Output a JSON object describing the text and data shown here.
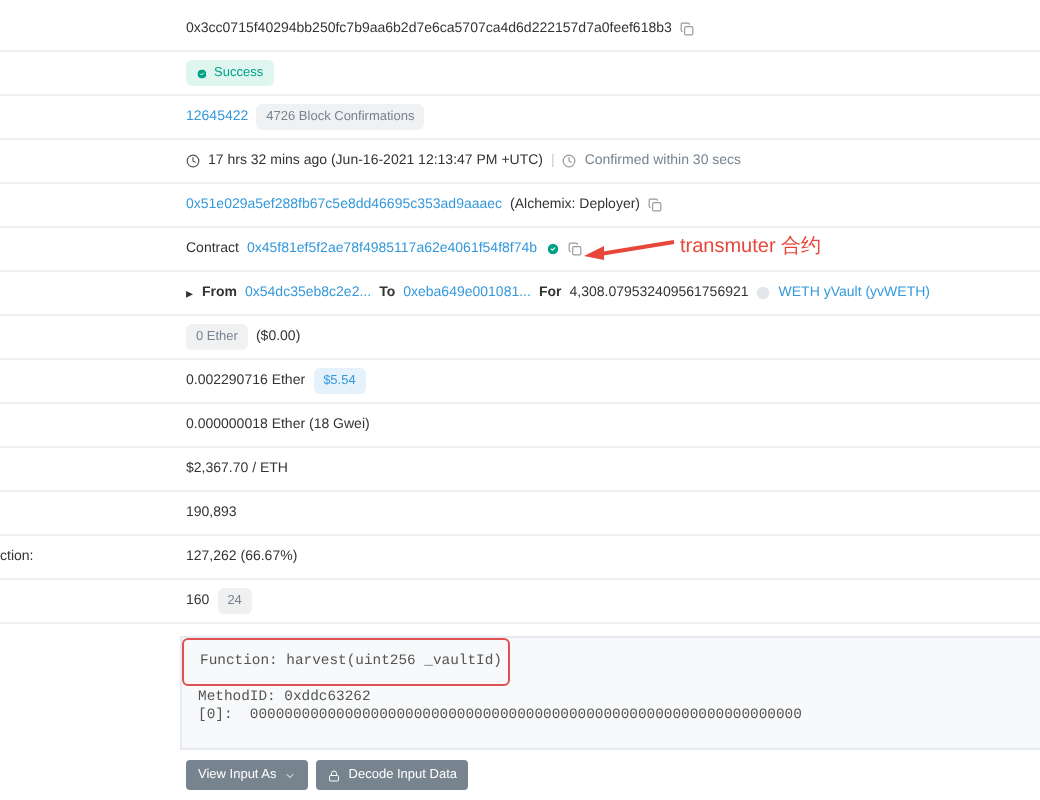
{
  "rows": [
    {
      "kind": "copytext",
      "label": "",
      "text": "0x3cc0715f40294bb250fc7b9aa6b2d7e6ca5707ca4d6d222157d7a0feef618b3"
    },
    {
      "kind": "status",
      "label": "",
      "text": "Success"
    },
    {
      "kind": "block",
      "label": "",
      "link": "12645422",
      "badge": "4726 Block Confirmations"
    },
    {
      "kind": "time",
      "label": "",
      "text": "17 hrs 32 mins ago (Jun-16-2021 12:13:47 PM +UTC)",
      "separator": "|",
      "note": "Confirmed within 30 secs"
    },
    {
      "kind": "address",
      "label": "",
      "link": "0x51e029a5ef288fb67c5e8dd46695c353ad9aaaec",
      "note": "(Alchemix: Deployer)"
    },
    {
      "kind": "contract",
      "label": "",
      "prefix": "Contract",
      "link": "0x45f81ef5f2ae78f4985117a62e4061f54f8f74b",
      "verified": true,
      "annotation": "transmuter 合约"
    },
    {
      "kind": "transfer",
      "label": "",
      "bullet": "▸",
      "from_label": "From",
      "from": "0x54dc35eb8c2e2...",
      "to_label": "To",
      "to": "0xeba649e001081...",
      "for_label": "For",
      "amount": "4,308.079532409561756921",
      "token": "WETH yVault (yvWETH)"
    },
    {
      "kind": "badgetext",
      "label": "",
      "badge": "0 Ether",
      "text": "($0.00)"
    },
    {
      "kind": "textbadge",
      "label": "",
      "text": "0.002290716 Ether",
      "badge": "$5.54",
      "color": "#3498db"
    },
    {
      "kind": "text",
      "label": "",
      "text": "0.000000018 Ether (18 Gwei)"
    },
    {
      "kind": "text",
      "label": "",
      "text": "$2,367.70 / ETH"
    },
    {
      "kind": "text",
      "label": "",
      "text": "190,893"
    },
    {
      "kind": "text",
      "label": "ction:",
      "text": "127,262 (66.67%)"
    },
    {
      "kind": "textbadge",
      "label": "",
      "text": "160",
      "badge": "24",
      "color": "#77838f"
    }
  ],
  "input": {
    "function": "Function: harvest(uint256 _vaultId)",
    "highlighted": true,
    "lines": [
      "MethodID: 0xddc63262",
      "[0]:  0000000000000000000000000000000000000000000000000000000000000000"
    ]
  },
  "buttons": [
    {
      "label": "View Input As",
      "kind": "dropdown"
    },
    {
      "label": "Decode Input Data",
      "kind": "decode"
    }
  ]
}
